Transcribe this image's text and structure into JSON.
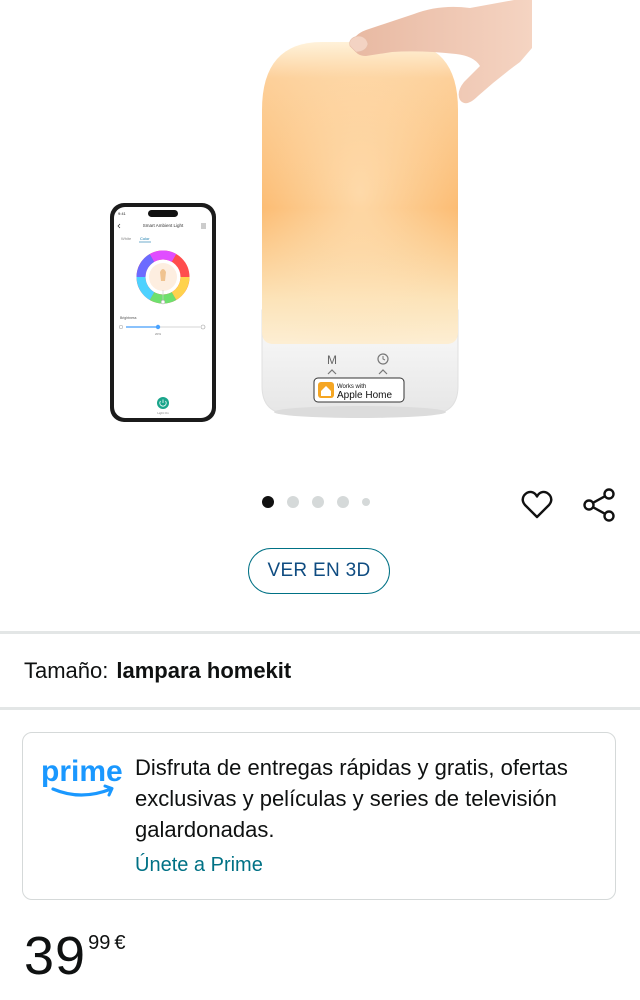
{
  "gallery": {
    "phone_app": {
      "title": "Smart Ambient Light",
      "tab_white": "White",
      "tab_color": "Color",
      "brightness_label": "Brightness",
      "brightness_value": "20%",
      "power_label": "Light On"
    },
    "lamp_badge": {
      "works_with": "Works with",
      "apple_home": "Apple Home",
      "mode_label": "M"
    },
    "image_count": 5,
    "active_index": 0
  },
  "actions": {
    "view_3d_label": "VER EN 3D",
    "favorite_icon": "heart-icon",
    "share_icon": "share-icon"
  },
  "variation": {
    "label": "Tamaño:",
    "value": "lampara homekit"
  },
  "prime": {
    "logo_text": "prime",
    "message": "Disfruta de entregas rápidas y gratis, ofertas exclusivas y películas y series de televisión galardonadas.",
    "link_label": "Únete a Prime"
  },
  "price": {
    "whole": "39",
    "fraction": "99",
    "currency": "€"
  },
  "colors": {
    "link": "#007185",
    "prime_blue": "#1a98ff",
    "lamp_glow": "#fbb76a",
    "divider": "#e3e6e6"
  }
}
